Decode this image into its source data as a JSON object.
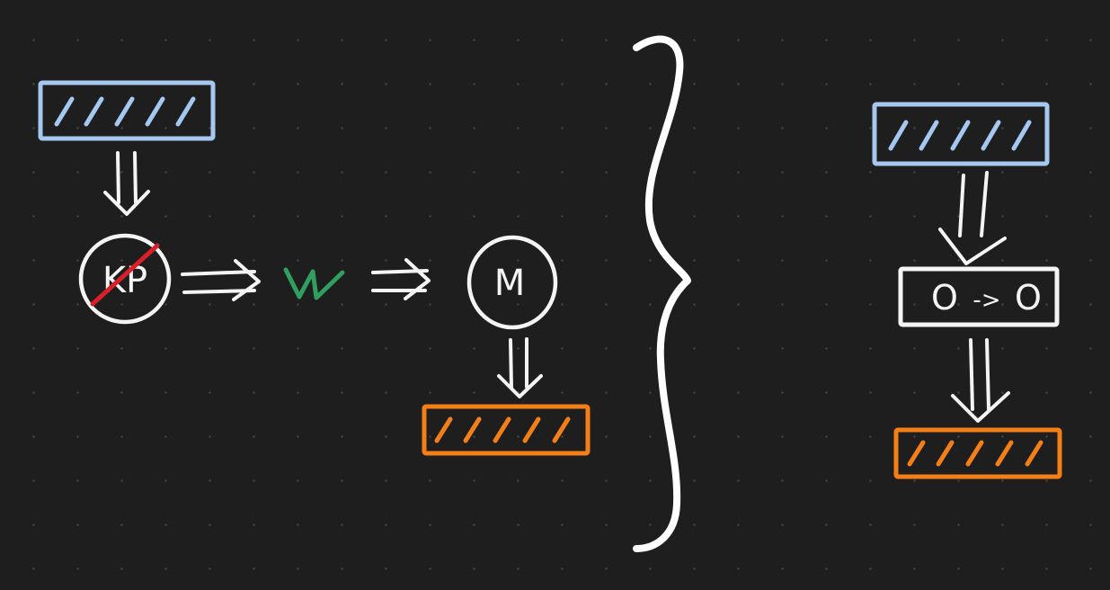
{
  "diagram": {
    "left_group": {
      "input_block": {
        "color": "#a5c8f0"
      },
      "crossed_node": {
        "label": "KP",
        "strike_color": "#d91f2a"
      },
      "link_symbol": {
        "label": "W",
        "color": "#2f9e5f"
      },
      "m_node": {
        "label": "M"
      },
      "output_block": {
        "color": "#f57f17"
      }
    },
    "brace": {
      "color": "#ffffff"
    },
    "right_group": {
      "input_block": {
        "color": "#a5c8f0"
      },
      "mapping_box": {
        "left": "O",
        "arrow": "->",
        "right": "O"
      },
      "output_block": {
        "color": "#f57f17"
      }
    }
  }
}
